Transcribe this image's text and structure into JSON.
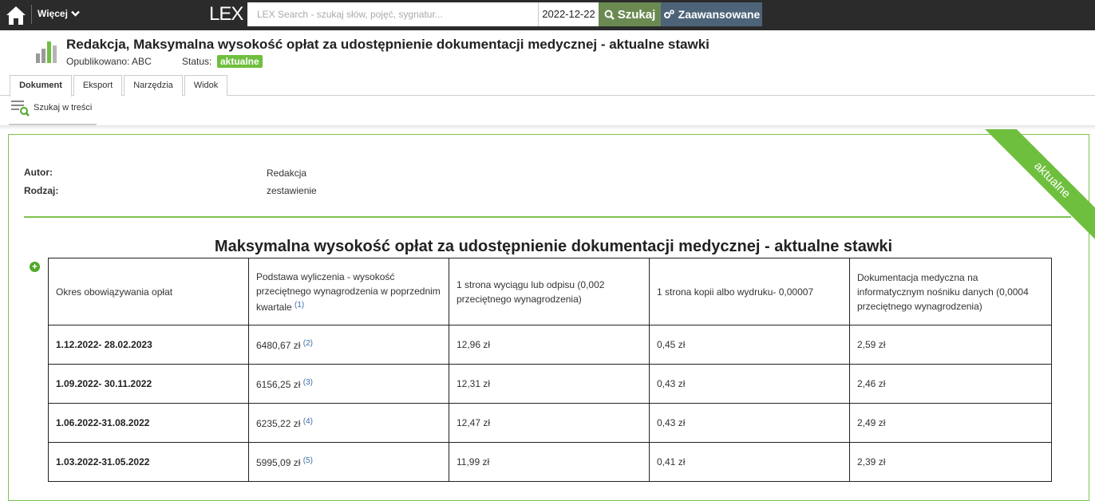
{
  "topbar": {
    "more_label": "Więcej",
    "logo": "LEX",
    "search_placeholder": "LEX Search - szukaj słów, pojęć, sygnatur...",
    "date": "2022-12-22",
    "search_button": "Szukaj",
    "advanced_button": "Zaawansowane"
  },
  "header": {
    "title": "Redakcja, Maksymalna wysokość opłat za udostępnienie dokumentacji medycznej - aktualne stawki",
    "published": "Opublikowano: ABC",
    "status_label": "Status:",
    "status_value": "aktualne"
  },
  "tabs": [
    {
      "label": "Dokument"
    },
    {
      "label": "Eksport"
    },
    {
      "label": "Narzędzia"
    },
    {
      "label": "Widok"
    }
  ],
  "toolbar": {
    "search_in_content": "Szukaj w treści"
  },
  "document": {
    "ribbon": "aktualne",
    "fields": [
      {
        "label": "Autor:",
        "value": "Redakcja"
      },
      {
        "label": "Rodzaj:",
        "value": "zestawienie"
      }
    ],
    "table_title": "Maksymalna wysokość opłat za udostępnienie dokumentacji medycznej - aktualne stawki",
    "table": {
      "headers": [
        "Okres obowiązywania opłat",
        "Podstawa wyliczenia - wysokość przeciętnego wynagrodzenia w poprzednim kwartale",
        "1 strona wyciągu lub odpisu (0,002 przeciętnego wynagrodzenia)",
        "1 strona kopii albo wydruku- 0,00007",
        "Dokumentacja medyczna na informatycznym nośniku danych (0,0004 przeciętnego wynagrodzenia)"
      ],
      "header_footnote": "(1)",
      "rows": [
        {
          "period": "1.12.2022- 28.02.2023",
          "base": "6480,67 zł",
          "note": "(2)",
          "extract": "12,96 zł",
          "copy": "0,45 zł",
          "digital": "2,59 zł"
        },
        {
          "period": "1.09.2022- 30.11.2022",
          "base": "6156,25 zł",
          "note": "(3)",
          "extract": "12,31 zł",
          "copy": "0,43 zł",
          "digital": "2,46 zł"
        },
        {
          "period": "1.06.2022-31.08.2022",
          "base": "6235,22 zł",
          "note": "(4)",
          "extract": "12,47 zł",
          "copy": "0,43 zł",
          "digital": "2,49 zł"
        },
        {
          "period": "1.03.2022-31.05.2022",
          "base": "5995,09 zł",
          "note": "(5)",
          "extract": "11,99 zł",
          "copy": "0,41 zł",
          "digital": "2,39 zł"
        }
      ]
    }
  },
  "colors": {
    "topbar": "#2b2b2b",
    "search_button": "#6a8a52",
    "advanced_button": "#4d6378",
    "status_green": "#6fbf3f",
    "border_green": "#7fc24f"
  }
}
